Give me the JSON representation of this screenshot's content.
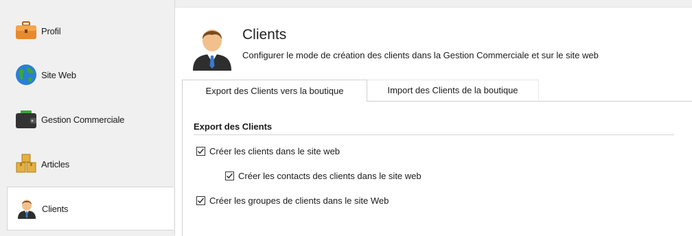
{
  "sidebar": {
    "items": [
      {
        "label": "Profil",
        "icon": "briefcase-icon"
      },
      {
        "label": "Site Web",
        "icon": "globe-icon"
      },
      {
        "label": "Gestion Commerciale",
        "icon": "wallet-icon"
      },
      {
        "label": "Articles",
        "icon": "boxes-icon"
      },
      {
        "label": "Clients",
        "icon": "user-icon",
        "active": true
      }
    ]
  },
  "header": {
    "title": "Clients",
    "subtitle": "Configurer le mode de création des clients dans la Gestion Commerciale et sur le site web"
  },
  "tabs": [
    {
      "label": "Export des Clients vers la boutique",
      "active": true
    },
    {
      "label": "Import des Clients de la boutique",
      "active": false
    }
  ],
  "group": {
    "title": "Export des Clients",
    "options": [
      {
        "label": "Créer les clients dans le site web",
        "checked": true
      },
      {
        "label": "Créer les contacts des clients dans le site web",
        "checked": true
      },
      {
        "label": "Créer les groupes de clients dans le site Web",
        "checked": true
      }
    ]
  },
  "colors": {
    "accent_orange": "#e8892b",
    "globe_blue": "#2a7fd4",
    "globe_green": "#3aa63a",
    "wallet_dark": "#333333",
    "tie_blue": "#3a78c9"
  }
}
